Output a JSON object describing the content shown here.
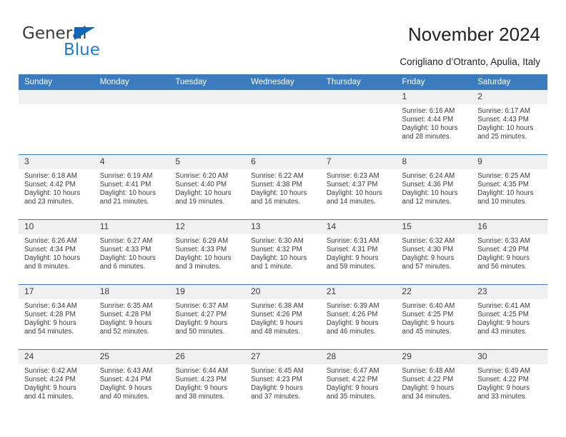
{
  "brand": {
    "name_part1": "General",
    "name_part2": "Blue",
    "accent_color": "#1a7fd4",
    "triangle_color": "#1266b5"
  },
  "header": {
    "title": "November 2024",
    "subtitle": "Corigliano d’Otranto, Apulia, Italy"
  },
  "calendar": {
    "header_bg": "#3a7cbe",
    "daynum_bg": "#f0f0f0",
    "weekdays": [
      "Sunday",
      "Monday",
      "Tuesday",
      "Wednesday",
      "Thursday",
      "Friday",
      "Saturday"
    ],
    "weeks": [
      [
        {
          "day": "",
          "empty": true
        },
        {
          "day": "",
          "empty": true
        },
        {
          "day": "",
          "empty": true
        },
        {
          "day": "",
          "empty": true
        },
        {
          "day": "",
          "empty": true
        },
        {
          "day": "1",
          "sunrise": "Sunrise: 6:16 AM",
          "sunset": "Sunset: 4:44 PM",
          "daylight1": "Daylight: 10 hours",
          "daylight2": "and 28 minutes."
        },
        {
          "day": "2",
          "sunrise": "Sunrise: 6:17 AM",
          "sunset": "Sunset: 4:43 PM",
          "daylight1": "Daylight: 10 hours",
          "daylight2": "and 25 minutes."
        }
      ],
      [
        {
          "day": "3",
          "sunrise": "Sunrise: 6:18 AM",
          "sunset": "Sunset: 4:42 PM",
          "daylight1": "Daylight: 10 hours",
          "daylight2": "and 23 minutes."
        },
        {
          "day": "4",
          "sunrise": "Sunrise: 6:19 AM",
          "sunset": "Sunset: 4:41 PM",
          "daylight1": "Daylight: 10 hours",
          "daylight2": "and 21 minutes."
        },
        {
          "day": "5",
          "sunrise": "Sunrise: 6:20 AM",
          "sunset": "Sunset: 4:40 PM",
          "daylight1": "Daylight: 10 hours",
          "daylight2": "and 19 minutes."
        },
        {
          "day": "6",
          "sunrise": "Sunrise: 6:22 AM",
          "sunset": "Sunset: 4:38 PM",
          "daylight1": "Daylight: 10 hours",
          "daylight2": "and 16 minutes."
        },
        {
          "day": "7",
          "sunrise": "Sunrise: 6:23 AM",
          "sunset": "Sunset: 4:37 PM",
          "daylight1": "Daylight: 10 hours",
          "daylight2": "and 14 minutes."
        },
        {
          "day": "8",
          "sunrise": "Sunrise: 6:24 AM",
          "sunset": "Sunset: 4:36 PM",
          "daylight1": "Daylight: 10 hours",
          "daylight2": "and 12 minutes."
        },
        {
          "day": "9",
          "sunrise": "Sunrise: 6:25 AM",
          "sunset": "Sunset: 4:35 PM",
          "daylight1": "Daylight: 10 hours",
          "daylight2": "and 10 minutes."
        }
      ],
      [
        {
          "day": "10",
          "sunrise": "Sunrise: 6:26 AM",
          "sunset": "Sunset: 4:34 PM",
          "daylight1": "Daylight: 10 hours",
          "daylight2": "and 8 minutes."
        },
        {
          "day": "11",
          "sunrise": "Sunrise: 6:27 AM",
          "sunset": "Sunset: 4:33 PM",
          "daylight1": "Daylight: 10 hours",
          "daylight2": "and 6 minutes."
        },
        {
          "day": "12",
          "sunrise": "Sunrise: 6:29 AM",
          "sunset": "Sunset: 4:33 PM",
          "daylight1": "Daylight: 10 hours",
          "daylight2": "and 3 minutes."
        },
        {
          "day": "13",
          "sunrise": "Sunrise: 6:30 AM",
          "sunset": "Sunset: 4:32 PM",
          "daylight1": "Daylight: 10 hours",
          "daylight2": "and 1 minute."
        },
        {
          "day": "14",
          "sunrise": "Sunrise: 6:31 AM",
          "sunset": "Sunset: 4:31 PM",
          "daylight1": "Daylight: 9 hours",
          "daylight2": "and 59 minutes."
        },
        {
          "day": "15",
          "sunrise": "Sunrise: 6:32 AM",
          "sunset": "Sunset: 4:30 PM",
          "daylight1": "Daylight: 9 hours",
          "daylight2": "and 57 minutes."
        },
        {
          "day": "16",
          "sunrise": "Sunrise: 6:33 AM",
          "sunset": "Sunset: 4:29 PM",
          "daylight1": "Daylight: 9 hours",
          "daylight2": "and 56 minutes."
        }
      ],
      [
        {
          "day": "17",
          "sunrise": "Sunrise: 6:34 AM",
          "sunset": "Sunset: 4:28 PM",
          "daylight1": "Daylight: 9 hours",
          "daylight2": "and 54 minutes."
        },
        {
          "day": "18",
          "sunrise": "Sunrise: 6:35 AM",
          "sunset": "Sunset: 4:28 PM",
          "daylight1": "Daylight: 9 hours",
          "daylight2": "and 52 minutes."
        },
        {
          "day": "19",
          "sunrise": "Sunrise: 6:37 AM",
          "sunset": "Sunset: 4:27 PM",
          "daylight1": "Daylight: 9 hours",
          "daylight2": "and 50 minutes."
        },
        {
          "day": "20",
          "sunrise": "Sunrise: 6:38 AM",
          "sunset": "Sunset: 4:26 PM",
          "daylight1": "Daylight: 9 hours",
          "daylight2": "and 48 minutes."
        },
        {
          "day": "21",
          "sunrise": "Sunrise: 6:39 AM",
          "sunset": "Sunset: 4:26 PM",
          "daylight1": "Daylight: 9 hours",
          "daylight2": "and 46 minutes."
        },
        {
          "day": "22",
          "sunrise": "Sunrise: 6:40 AM",
          "sunset": "Sunset: 4:25 PM",
          "daylight1": "Daylight: 9 hours",
          "daylight2": "and 45 minutes."
        },
        {
          "day": "23",
          "sunrise": "Sunrise: 6:41 AM",
          "sunset": "Sunset: 4:25 PM",
          "daylight1": "Daylight: 9 hours",
          "daylight2": "and 43 minutes."
        }
      ],
      [
        {
          "day": "24",
          "sunrise": "Sunrise: 6:42 AM",
          "sunset": "Sunset: 4:24 PM",
          "daylight1": "Daylight: 9 hours",
          "daylight2": "and 41 minutes."
        },
        {
          "day": "25",
          "sunrise": "Sunrise: 6:43 AM",
          "sunset": "Sunset: 4:24 PM",
          "daylight1": "Daylight: 9 hours",
          "daylight2": "and 40 minutes."
        },
        {
          "day": "26",
          "sunrise": "Sunrise: 6:44 AM",
          "sunset": "Sunset: 4:23 PM",
          "daylight1": "Daylight: 9 hours",
          "daylight2": "and 38 minutes."
        },
        {
          "day": "27",
          "sunrise": "Sunrise: 6:45 AM",
          "sunset": "Sunset: 4:23 PM",
          "daylight1": "Daylight: 9 hours",
          "daylight2": "and 37 minutes."
        },
        {
          "day": "28",
          "sunrise": "Sunrise: 6:47 AM",
          "sunset": "Sunset: 4:22 PM",
          "daylight1": "Daylight: 9 hours",
          "daylight2": "and 35 minutes."
        },
        {
          "day": "29",
          "sunrise": "Sunrise: 6:48 AM",
          "sunset": "Sunset: 4:22 PM",
          "daylight1": "Daylight: 9 hours",
          "daylight2": "and 34 minutes."
        },
        {
          "day": "30",
          "sunrise": "Sunrise: 6:49 AM",
          "sunset": "Sunset: 4:22 PM",
          "daylight1": "Daylight: 9 hours",
          "daylight2": "and 33 minutes."
        }
      ]
    ]
  }
}
